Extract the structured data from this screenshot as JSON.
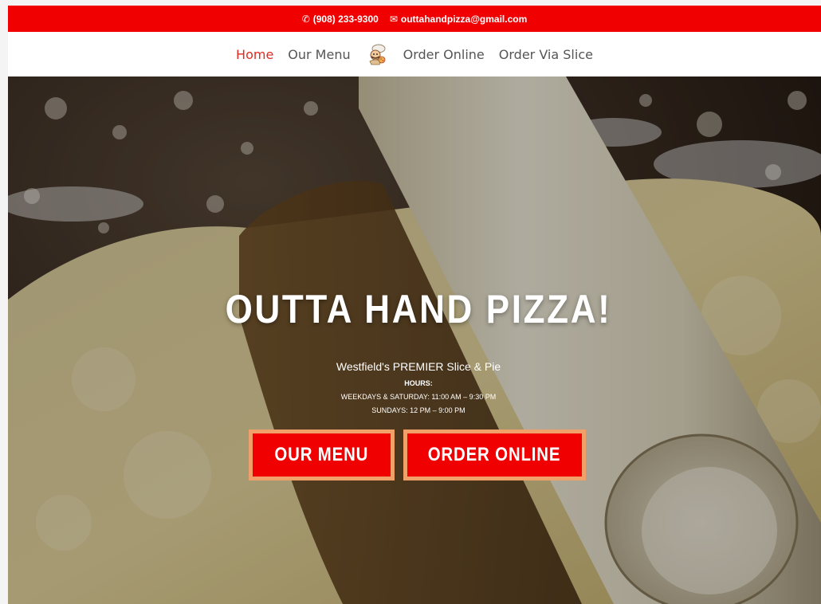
{
  "topbar": {
    "phone": "(908) 233-9300",
    "email": "outtahandpizza@gmail.com",
    "phone_icon": "phone-icon",
    "email_icon": "envelope-icon",
    "color": "#f00000"
  },
  "nav": {
    "items": [
      {
        "label": "Home",
        "active": true
      },
      {
        "label": "Our Menu"
      },
      {
        "label": "Order Online"
      },
      {
        "label": "Order Via Slice"
      }
    ],
    "logo_icon": "chef-logo-icon",
    "active_color": "#e02b20"
  },
  "hero": {
    "title": "OUTTA HAND PIZZA!",
    "tagline": "Westfield's PREMIER Slice & Pie",
    "hours_label": "HOURS:",
    "hours_weekdays": "WEEKDAYS & SATURDAY: 11:00 AM – 9:30 PM",
    "hours_sundays": "SUNDAYS: 12 PM – 9:00 PM",
    "buttons": {
      "menu": "OUR MENU",
      "order": "ORDER ONLINE"
    },
    "button_color": "#f00000",
    "button_border": "#f2a06a"
  }
}
